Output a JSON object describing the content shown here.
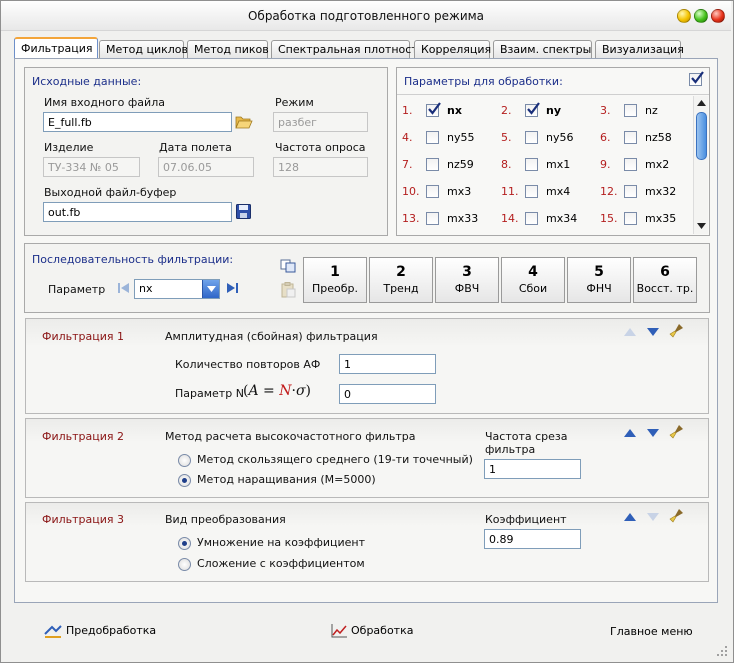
{
  "window": {
    "title": "Обработка подготовленного режима"
  },
  "tabs": [
    {
      "label": "Фильтрация",
      "active": true
    },
    {
      "label": "Метод циклов"
    },
    {
      "label": "Метод пиков"
    },
    {
      "label": "Спектральная плотность"
    },
    {
      "label": "Корреляция"
    },
    {
      "label": "Взаим. спектры"
    },
    {
      "label": "Визуализация"
    }
  ],
  "source": {
    "title": "Исходные данные:",
    "input_file_label": "Имя входного файла",
    "input_file_value": "E_full.fb",
    "mode_label": "Режим",
    "mode_value": "разбег",
    "product_label": "Изделие",
    "product_value": "ТУ-334 № 05",
    "flight_date_label": "Дата полета",
    "flight_date_value": "07.06.05",
    "sample_rate_label": "Частота опроса",
    "sample_rate_value": "128",
    "output_file_label": "Выходной файл-буфер",
    "output_file_value": "out.fb"
  },
  "params": {
    "title": "Параметры для обработки:",
    "select_all": true,
    "items": [
      {
        "num": "1.",
        "name": "nx",
        "checked": true
      },
      {
        "num": "2.",
        "name": "ny",
        "checked": true
      },
      {
        "num": "3.",
        "name": "nz",
        "checked": false
      },
      {
        "num": "4.",
        "name": "ny55",
        "checked": false
      },
      {
        "num": "5.",
        "name": "ny56",
        "checked": false
      },
      {
        "num": "6.",
        "name": "nz58",
        "checked": false
      },
      {
        "num": "7.",
        "name": "nz59",
        "checked": false
      },
      {
        "num": "8.",
        "name": "mx1",
        "checked": false
      },
      {
        "num": "9.",
        "name": "mx2",
        "checked": false
      },
      {
        "num": "10.",
        "name": "mx3",
        "checked": false
      },
      {
        "num": "11.",
        "name": "mx4",
        "checked": false
      },
      {
        "num": "12.",
        "name": "mx32",
        "checked": false
      },
      {
        "num": "13.",
        "name": "mx33",
        "checked": false
      },
      {
        "num": "14.",
        "name": "mx34",
        "checked": false
      },
      {
        "num": "15.",
        "name": "mx35",
        "checked": false
      }
    ]
  },
  "sequence": {
    "title": "Последовательность фильтрации:",
    "param_label": "Параметр",
    "param_value": "nx",
    "steps": [
      {
        "n": "1",
        "label": "Преобр."
      },
      {
        "n": "2",
        "label": "Тренд"
      },
      {
        "n": "3",
        "label": "ФВЧ"
      },
      {
        "n": "4",
        "label": "Сбои"
      },
      {
        "n": "5",
        "label": "ФНЧ"
      },
      {
        "n": "6",
        "label": "Восст. тр."
      }
    ]
  },
  "filter1": {
    "name": "Фильтрация 1",
    "title": "Амплитудная (сбойная) фильтрация",
    "repeats_label": "Количество повторов АФ",
    "repeats_value": "1",
    "paramN_label": "Параметр N",
    "formula_a": "A",
    "formula_eq": "=",
    "formula_n": "N",
    "formula_dot": "·",
    "formula_sigma": "σ",
    "paramN_value": "0"
  },
  "filter2": {
    "name": "Фильтрация 2",
    "title": "Метод расчета высокочастотного фильтра",
    "option1": "Метод скользящего среднего (19-ти точечный)",
    "option2": "Метод наращивания (M=5000)",
    "selected": 2,
    "cutoff_label_1": "Частота среза",
    "cutoff_label_2": "фильтра",
    "cutoff_value": "1"
  },
  "filter3": {
    "name": "Фильтрация 3",
    "title": "Вид преобразования",
    "option1": "Умножение на коэффициент",
    "option2": "Сложение с коэффициентом",
    "selected": 1,
    "coef_label": "Коэффициент",
    "coef_value": "0.89"
  },
  "footer": {
    "preprocess": "Предобработка",
    "process": "Обработка",
    "main_menu": "Главное меню"
  },
  "colors": {
    "accent_blue": "#1c2f8a",
    "filter_red": "#8a1414",
    "num_red": "#b41e1e"
  }
}
